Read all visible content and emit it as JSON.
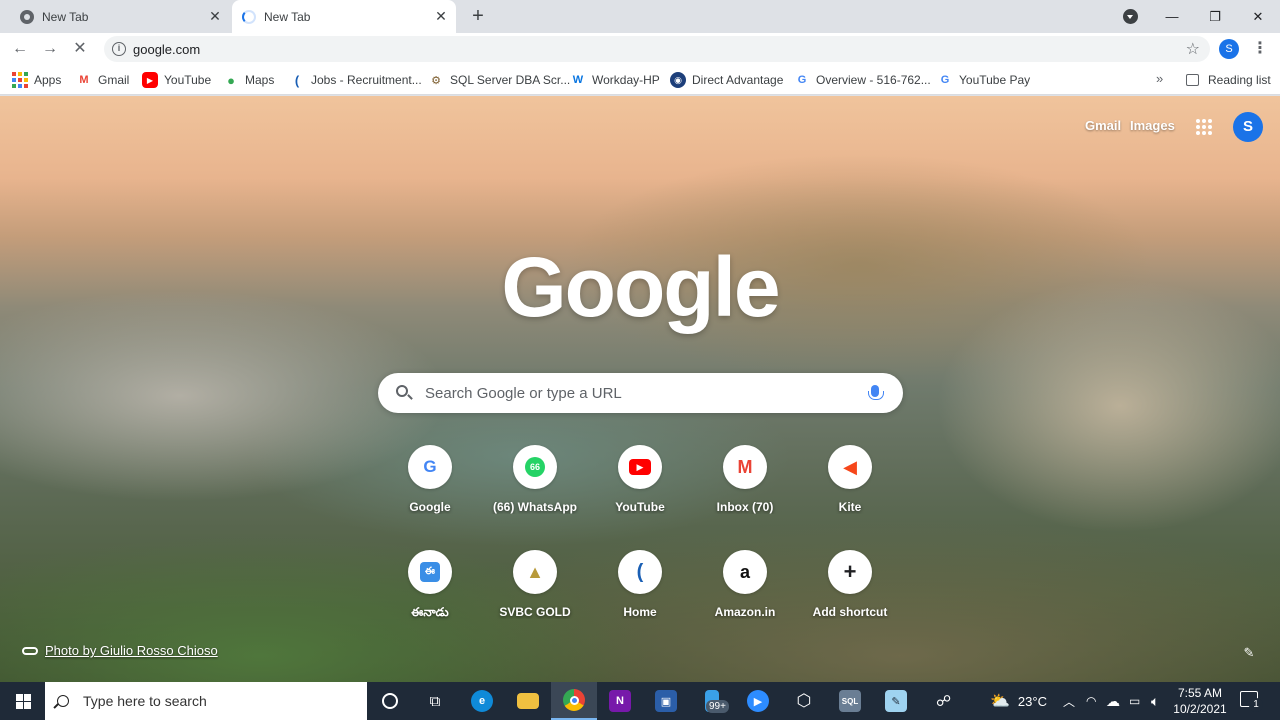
{
  "tabs": [
    {
      "title": "New Tab",
      "state": "idle"
    },
    {
      "title": "New Tab",
      "state": "loading"
    }
  ],
  "toolbar": {
    "url": "google.com",
    "profile_initial": "S"
  },
  "bookmarks": [
    {
      "label": "Apps",
      "icon": "apps-grid-icon"
    },
    {
      "label": "Gmail",
      "icon": "gmail-icon"
    },
    {
      "label": "YouTube",
      "icon": "youtube-icon"
    },
    {
      "label": "Maps",
      "icon": "maps-icon"
    },
    {
      "label": "Jobs - Recruitment...",
      "icon": "kite-icon"
    },
    {
      "label": "SQL Server DBA Scr...",
      "icon": "sql-icon"
    },
    {
      "label": "Workday-HP",
      "icon": "workday-icon"
    },
    {
      "label": "Direct Advantage",
      "icon": "globe-icon"
    },
    {
      "label": "Overview - 516-762...",
      "icon": "google-g-icon"
    },
    {
      "label": "YouTube Pay",
      "icon": "google-g-icon"
    }
  ],
  "reading_list": "Reading list",
  "ntp": {
    "links": [
      "Gmail",
      "Images"
    ],
    "profile_initial": "S",
    "logo": "Google",
    "search_placeholder": "Search Google or type a URL",
    "shortcuts": [
      {
        "label": "Google",
        "icon": "google-g-icon"
      },
      {
        "label": "(66) WhatsApp",
        "icon": "whatsapp-icon"
      },
      {
        "label": "YouTube",
        "icon": "youtube-icon"
      },
      {
        "label": "Inbox (70)",
        "icon": "gmail-icon"
      },
      {
        "label": "Kite",
        "icon": "kite-icon"
      },
      {
        "label": "ఈనాడు",
        "icon": "eenadu-icon"
      },
      {
        "label": "SVBC GOLD",
        "icon": "svbc-icon"
      },
      {
        "label": "Home",
        "icon": "kite-icon"
      },
      {
        "label": "Amazon.in",
        "icon": "amazon-icon"
      },
      {
        "label": "Add shortcut",
        "icon": "plus-icon"
      }
    ],
    "photo_credit": "Photo by Giulio Rosso Chioso"
  },
  "taskbar": {
    "search_placeholder": "Type here to search",
    "badge": "99+",
    "weather": "23°C",
    "time": "7:55 AM",
    "date": "10/2/2021",
    "notification_count": "1"
  },
  "colors": {
    "accent": "#1a73e8",
    "tabstrip": "#dee1e6",
    "taskbar": "#1f2a38"
  }
}
